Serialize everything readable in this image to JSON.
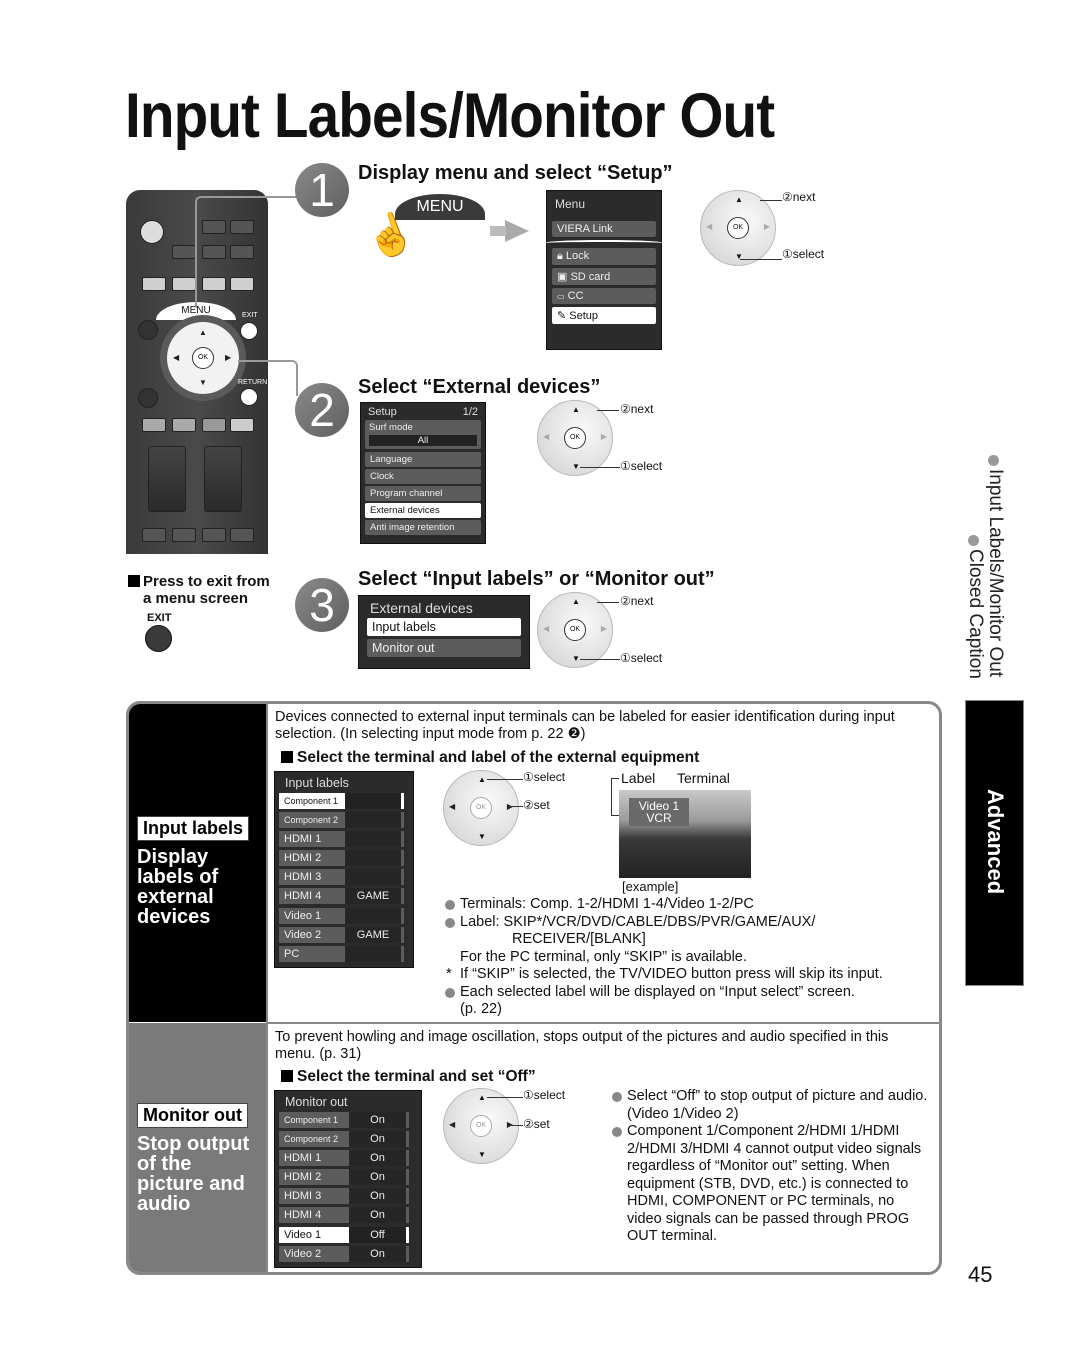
{
  "page": {
    "title": "Input Labels/Monitor Out",
    "page_number": "45"
  },
  "remote": {
    "menu_label": "MENU",
    "exit_label": "EXIT",
    "return_label": "RETURN",
    "ok_label": "OK"
  },
  "step1": {
    "number": "1",
    "title": "Display menu and select “Setup”",
    "menu_button": "MENU",
    "menu": {
      "header": "Menu",
      "items": [
        {
          "icon": "",
          "label": "VIERA Link"
        },
        {
          "icon": "lock-icon",
          "label": "Lock"
        },
        {
          "icon": "sd-card-icon",
          "label": "SD card"
        },
        {
          "icon": "cc-icon",
          "label": "CC"
        },
        {
          "icon": "setup-icon",
          "label": "Setup",
          "selected": true
        }
      ]
    },
    "nav": {
      "next": "②next",
      "select": "①select",
      "ok": "OK"
    }
  },
  "step2": {
    "number": "2",
    "title": "Select “External devices”",
    "menu": {
      "header": "Setup",
      "page": "1/2",
      "surf_mode_label": "Surf mode",
      "surf_mode_value": "All",
      "items": [
        "Language",
        "Clock",
        "Program channel",
        "External devices",
        "Anti image retention"
      ],
      "selected_index": 3
    },
    "nav": {
      "next": "②next",
      "select": "①select",
      "ok": "OK"
    }
  },
  "step3": {
    "number": "3",
    "title": "Select “Input labels” or “Monitor out”",
    "menu": {
      "header": "External devices",
      "items": [
        "Input labels",
        "Monitor out"
      ],
      "selected_index": 0
    },
    "nav": {
      "next": "②next",
      "select": "①select",
      "ok": "OK"
    }
  },
  "exit_note": {
    "line1": "Press to exit from",
    "line2": "a menu screen",
    "button_label": "EXIT"
  },
  "side": {
    "topic1": "Input Labels/Monitor Out",
    "topic2": "Closed Caption",
    "section_tab": "Advanced"
  },
  "input_labels": {
    "tag": "Input labels",
    "heading": "Display labels of external devices",
    "description": "Devices connected to external input terminals can be labeled for easier identification during input selection. (In selecting input mode from p. 22 ❷)",
    "subheading": "Select the terminal and label of the external equipment",
    "table": {
      "header": "Input labels",
      "rows": [
        {
          "terminal": "Component 1",
          "label": "",
          "selected": true
        },
        {
          "terminal": "Component 2",
          "label": ""
        },
        {
          "terminal": "HDMI 1",
          "label": ""
        },
        {
          "terminal": "HDMI 2",
          "label": ""
        },
        {
          "terminal": "HDMI 3",
          "label": ""
        },
        {
          "terminal": "HDMI 4",
          "label": "GAME"
        },
        {
          "terminal": "Video 1",
          "label": ""
        },
        {
          "terminal": "Video 2",
          "label": "GAME"
        },
        {
          "terminal": "PC",
          "label": ""
        }
      ]
    },
    "nav": {
      "select": "①select",
      "set": "②set",
      "ok": "OK"
    },
    "example": {
      "label_caption": "Label",
      "terminal_caption": "Terminal",
      "overlay_terminal": "Video 1",
      "overlay_label": "VCR",
      "caption": "[example]"
    },
    "notes": [
      {
        "type": "bullet",
        "text": "Terminals:  Comp. 1-2/HDMI 1-4/Video 1-2/PC"
      },
      {
        "type": "bullet",
        "text": "Label:  SKIP*/VCR/DVD/CABLE/DBS/PVR/GAME/AUX/"
      },
      {
        "type": "cont-indent",
        "text": "RECEIVER/[BLANK]"
      },
      {
        "type": "cont",
        "text": "For the PC terminal, only “SKIP” is available."
      },
      {
        "type": "asterisk",
        "text": "If “SKIP” is selected, the TV/VIDEO button press will skip its input."
      },
      {
        "type": "bullet",
        "text": "Each selected label will be displayed on “Input select” screen."
      },
      {
        "type": "cont",
        "text": "(p. 22)"
      }
    ]
  },
  "monitor_out": {
    "tag": "Monitor out",
    "heading": "Stop output of the picture and audio",
    "description": "To prevent howling and image oscillation, stops output of the pictures and audio specified in this menu. (p. 31)",
    "subheading": "Select the terminal and set “Off”",
    "table": {
      "header": "Monitor out",
      "rows": [
        {
          "terminal": "Component 1",
          "value": "On"
        },
        {
          "terminal": "Component 2",
          "value": "On"
        },
        {
          "terminal": "HDMI 1",
          "value": "On"
        },
        {
          "terminal": "HDMI 2",
          "value": "On"
        },
        {
          "terminal": "HDMI 3",
          "value": "On"
        },
        {
          "terminal": "HDMI 4",
          "value": "On"
        },
        {
          "terminal": "Video 1",
          "value": "Off",
          "selected": true
        },
        {
          "terminal": "Video 2",
          "value": "On"
        }
      ]
    },
    "nav": {
      "select": "①select",
      "set": "②set",
      "ok": "OK"
    },
    "notes": [
      "Select “Off” to stop output of picture and audio. (Video 1/Video 2)",
      "Component 1/Component 2/HDMI 1/HDMI 2/HDMI 3/HDMI 4 cannot output video signals regardless of “Monitor out” setting. When equipment (STB, DVD, etc.) is connected to HDMI, COMPONENT or PC terminals, no video signals can be passed through PROG OUT terminal."
    ]
  }
}
